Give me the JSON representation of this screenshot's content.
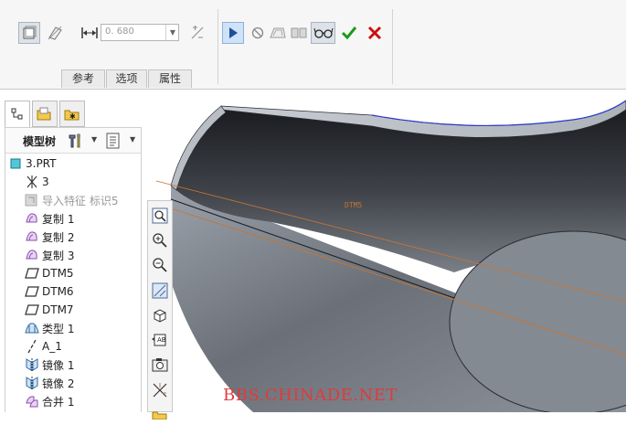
{
  "dashboard": {
    "thickness_value": "0. 680",
    "tabs": [
      "参考",
      "选项",
      "属性"
    ]
  },
  "model_tree": {
    "header_label": "模型树",
    "items": [
      {
        "label": "3.PRT",
        "icon": "part-icon"
      },
      {
        "label": "3",
        "icon": "default-csys-icon"
      },
      {
        "label": "导入特征 标识5",
        "icon": "import-feature-icon"
      },
      {
        "label": "复制 1",
        "icon": "copy-surface-icon"
      },
      {
        "label": "复制 2",
        "icon": "copy-surface-icon"
      },
      {
        "label": "复制 3",
        "icon": "copy-surface-icon"
      },
      {
        "label": "DTM5",
        "icon": "datum-plane-icon"
      },
      {
        "label": "DTM6",
        "icon": "datum-plane-icon"
      },
      {
        "label": "DTM7",
        "icon": "datum-plane-icon"
      },
      {
        "label": "类型 1",
        "icon": "boundary-blend-icon"
      },
      {
        "label": "A_1",
        "icon": "datum-axis-icon"
      },
      {
        "label": "镜像 1",
        "icon": "mirror-icon"
      },
      {
        "label": "镜像 2",
        "icon": "mirror-icon"
      },
      {
        "label": "合并 1",
        "icon": "merge-icon"
      }
    ]
  },
  "viewport": {
    "datum_label": "DTM5"
  },
  "watermark": "BBS.CHINADE.NET",
  "colors": {
    "accent_green": "#1a9a1a",
    "cancel_red": "#cc1111",
    "datum_orange": "#c87533",
    "active_blue": "#1f4f9a"
  }
}
